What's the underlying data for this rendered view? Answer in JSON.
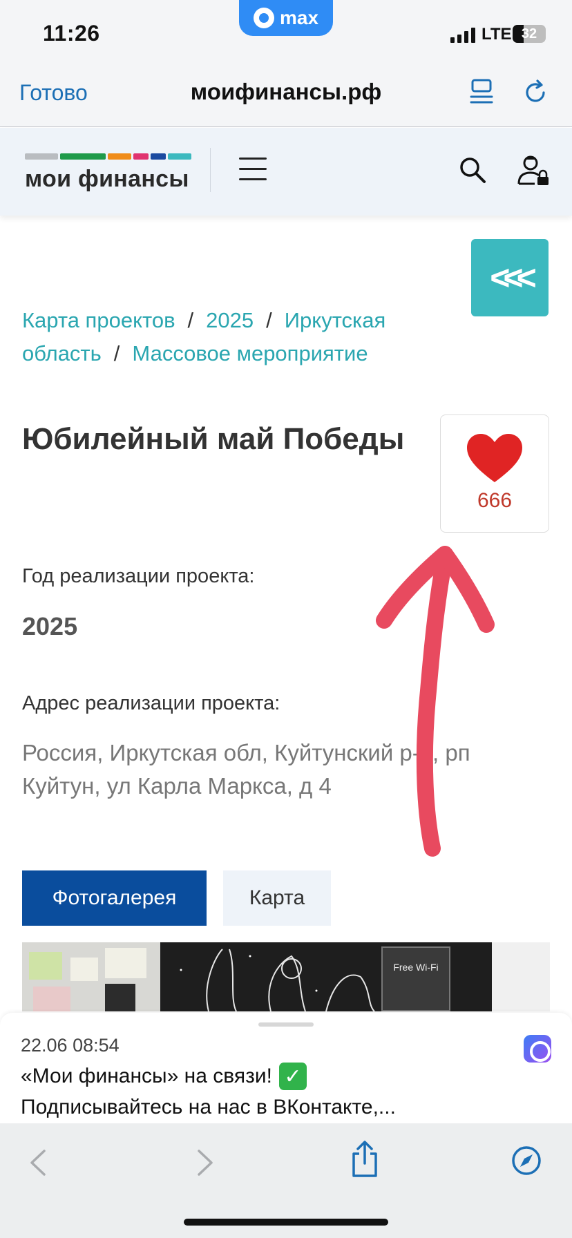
{
  "status_bar": {
    "time": "11:26",
    "app_pill": "max",
    "network": "LTE",
    "battery": "32"
  },
  "browser": {
    "done_label": "Готово",
    "url": "моифинансы.рф",
    "reader_icon": "reader-icon",
    "reload_icon": "reload-icon"
  },
  "site_header": {
    "logo_text": "мои финансы",
    "logo_bar_colors": [
      "#b9bcc0",
      "#1f9a4a",
      "#f08c1a",
      "#e0336f",
      "#1b4aa0",
      "#3cb9bf"
    ],
    "menu_icon": "hamburger-icon",
    "search_icon": "search-icon",
    "user_icon": "user-lock-icon"
  },
  "back_button": {
    "label": "<<<",
    "color": "#3cb9bf"
  },
  "breadcrumb": {
    "items": [
      "Карта проектов",
      "2025",
      "Иркутская область",
      "Массовое мероприятие"
    ],
    "separator": "/"
  },
  "project": {
    "title": "Юбилейный май Победы",
    "likes": "666",
    "year_label": "Год реализации проекта:",
    "year": "2025",
    "address_label": "Адрес реализации проекта:",
    "address": "Россия, Иркутская обл, Куйтунский р-н, рп Куйтун, ул Карла Маркса, д 4"
  },
  "tabs": {
    "gallery": "Фотогалерея",
    "map": "Карта"
  },
  "photo": {
    "wifi_text": "Free Wi-Fi"
  },
  "notification": {
    "time": "22.06  08:54",
    "line1": "«Мои финансы» на связи!",
    "line2": "Подписывайтесь на нас в ВКонтакте,..."
  },
  "colors": {
    "accent_teal": "#3cb9bf",
    "link": "#2aa6b0",
    "primary_blue": "#0a4d9d",
    "heart_red": "#e02424",
    "annotation_red": "#e84a5f"
  }
}
